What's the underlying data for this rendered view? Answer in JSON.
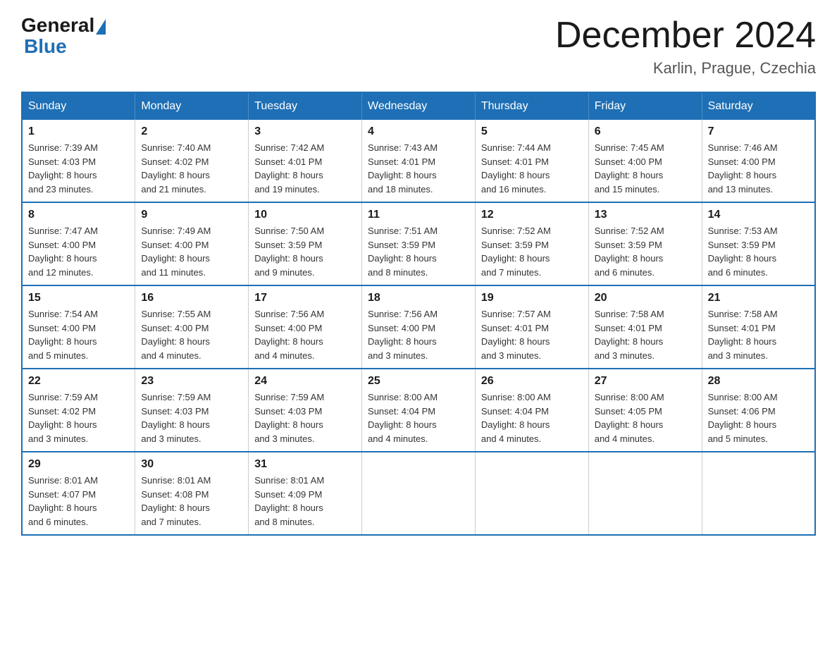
{
  "header": {
    "logo_general": "General",
    "logo_blue": "Blue",
    "month_title": "December 2024",
    "location": "Karlin, Prague, Czechia"
  },
  "weekdays": [
    "Sunday",
    "Monday",
    "Tuesday",
    "Wednesday",
    "Thursday",
    "Friday",
    "Saturday"
  ],
  "weeks": [
    [
      {
        "day": "1",
        "sunrise": "7:39 AM",
        "sunset": "4:03 PM",
        "daylight": "8 hours and 23 minutes."
      },
      {
        "day": "2",
        "sunrise": "7:40 AM",
        "sunset": "4:02 PM",
        "daylight": "8 hours and 21 minutes."
      },
      {
        "day": "3",
        "sunrise": "7:42 AM",
        "sunset": "4:01 PM",
        "daylight": "8 hours and 19 minutes."
      },
      {
        "day": "4",
        "sunrise": "7:43 AM",
        "sunset": "4:01 PM",
        "daylight": "8 hours and 18 minutes."
      },
      {
        "day": "5",
        "sunrise": "7:44 AM",
        "sunset": "4:01 PM",
        "daylight": "8 hours and 16 minutes."
      },
      {
        "day": "6",
        "sunrise": "7:45 AM",
        "sunset": "4:00 PM",
        "daylight": "8 hours and 15 minutes."
      },
      {
        "day": "7",
        "sunrise": "7:46 AM",
        "sunset": "4:00 PM",
        "daylight": "8 hours and 13 minutes."
      }
    ],
    [
      {
        "day": "8",
        "sunrise": "7:47 AM",
        "sunset": "4:00 PM",
        "daylight": "8 hours and 12 minutes."
      },
      {
        "day": "9",
        "sunrise": "7:49 AM",
        "sunset": "4:00 PM",
        "daylight": "8 hours and 11 minutes."
      },
      {
        "day": "10",
        "sunrise": "7:50 AM",
        "sunset": "3:59 PM",
        "daylight": "8 hours and 9 minutes."
      },
      {
        "day": "11",
        "sunrise": "7:51 AM",
        "sunset": "3:59 PM",
        "daylight": "8 hours and 8 minutes."
      },
      {
        "day": "12",
        "sunrise": "7:52 AM",
        "sunset": "3:59 PM",
        "daylight": "8 hours and 7 minutes."
      },
      {
        "day": "13",
        "sunrise": "7:52 AM",
        "sunset": "3:59 PM",
        "daylight": "8 hours and 6 minutes."
      },
      {
        "day": "14",
        "sunrise": "7:53 AM",
        "sunset": "3:59 PM",
        "daylight": "8 hours and 6 minutes."
      }
    ],
    [
      {
        "day": "15",
        "sunrise": "7:54 AM",
        "sunset": "4:00 PM",
        "daylight": "8 hours and 5 minutes."
      },
      {
        "day": "16",
        "sunrise": "7:55 AM",
        "sunset": "4:00 PM",
        "daylight": "8 hours and 4 minutes."
      },
      {
        "day": "17",
        "sunrise": "7:56 AM",
        "sunset": "4:00 PM",
        "daylight": "8 hours and 4 minutes."
      },
      {
        "day": "18",
        "sunrise": "7:56 AM",
        "sunset": "4:00 PM",
        "daylight": "8 hours and 3 minutes."
      },
      {
        "day": "19",
        "sunrise": "7:57 AM",
        "sunset": "4:01 PM",
        "daylight": "8 hours and 3 minutes."
      },
      {
        "day": "20",
        "sunrise": "7:58 AM",
        "sunset": "4:01 PM",
        "daylight": "8 hours and 3 minutes."
      },
      {
        "day": "21",
        "sunrise": "7:58 AM",
        "sunset": "4:01 PM",
        "daylight": "8 hours and 3 minutes."
      }
    ],
    [
      {
        "day": "22",
        "sunrise": "7:59 AM",
        "sunset": "4:02 PM",
        "daylight": "8 hours and 3 minutes."
      },
      {
        "day": "23",
        "sunrise": "7:59 AM",
        "sunset": "4:03 PM",
        "daylight": "8 hours and 3 minutes."
      },
      {
        "day": "24",
        "sunrise": "7:59 AM",
        "sunset": "4:03 PM",
        "daylight": "8 hours and 3 minutes."
      },
      {
        "day": "25",
        "sunrise": "8:00 AM",
        "sunset": "4:04 PM",
        "daylight": "8 hours and 4 minutes."
      },
      {
        "day": "26",
        "sunrise": "8:00 AM",
        "sunset": "4:04 PM",
        "daylight": "8 hours and 4 minutes."
      },
      {
        "day": "27",
        "sunrise": "8:00 AM",
        "sunset": "4:05 PM",
        "daylight": "8 hours and 4 minutes."
      },
      {
        "day": "28",
        "sunrise": "8:00 AM",
        "sunset": "4:06 PM",
        "daylight": "8 hours and 5 minutes."
      }
    ],
    [
      {
        "day": "29",
        "sunrise": "8:01 AM",
        "sunset": "4:07 PM",
        "daylight": "8 hours and 6 minutes."
      },
      {
        "day": "30",
        "sunrise": "8:01 AM",
        "sunset": "4:08 PM",
        "daylight": "8 hours and 7 minutes."
      },
      {
        "day": "31",
        "sunrise": "8:01 AM",
        "sunset": "4:09 PM",
        "daylight": "8 hours and 8 minutes."
      },
      null,
      null,
      null,
      null
    ]
  ],
  "labels": {
    "sunrise": "Sunrise:",
    "sunset": "Sunset:",
    "daylight": "Daylight:"
  }
}
